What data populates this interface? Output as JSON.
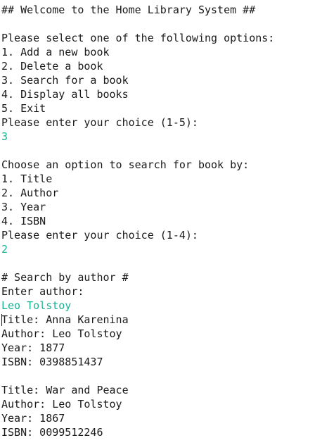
{
  "console": {
    "lines": [
      {
        "text": "## Welcome to the Home Library System ##",
        "type": "output"
      },
      {
        "text": "",
        "type": "blank"
      },
      {
        "text": "Please select one of the following options:",
        "type": "output"
      },
      {
        "text": "1. Add a new book",
        "type": "output"
      },
      {
        "text": "2. Delete a book",
        "type": "output"
      },
      {
        "text": "3. Search for a book",
        "type": "output"
      },
      {
        "text": "4. Display all books",
        "type": "output"
      },
      {
        "text": "5. Exit",
        "type": "output"
      },
      {
        "text": "Please enter your choice (1-5):",
        "type": "output"
      },
      {
        "text": "3",
        "type": "input"
      },
      {
        "text": "",
        "type": "blank"
      },
      {
        "text": "Choose an option to search for book by:",
        "type": "output"
      },
      {
        "text": "1. Title",
        "type": "output"
      },
      {
        "text": "2. Author",
        "type": "output"
      },
      {
        "text": "3. Year",
        "type": "output"
      },
      {
        "text": "4. ISBN",
        "type": "output"
      },
      {
        "text": "Please enter your choice (1-4):",
        "type": "output"
      },
      {
        "text": "2",
        "type": "input"
      },
      {
        "text": "",
        "type": "blank"
      },
      {
        "text": "# Search by author #",
        "type": "output"
      },
      {
        "text": "Enter author:",
        "type": "output"
      },
      {
        "text": "Leo Tolstoy",
        "type": "input"
      },
      {
        "text": "Title: Anna Karenina",
        "type": "output",
        "cursor": true
      },
      {
        "text": "Author: Leo Tolstoy",
        "type": "output"
      },
      {
        "text": "Year: 1877",
        "type": "output"
      },
      {
        "text": "ISBN: 0398851437",
        "type": "output"
      },
      {
        "text": "",
        "type": "blank"
      },
      {
        "text": "Title: War and Peace",
        "type": "output"
      },
      {
        "text": "Author: Leo Tolstoy",
        "type": "output"
      },
      {
        "text": "Year: 1867",
        "type": "output"
      },
      {
        "text": "ISBN: 0099512246",
        "type": "output"
      }
    ]
  },
  "colors": {
    "output_text": "#1a1a1a",
    "input_text": "#1ab394",
    "background": "#ffffff"
  }
}
